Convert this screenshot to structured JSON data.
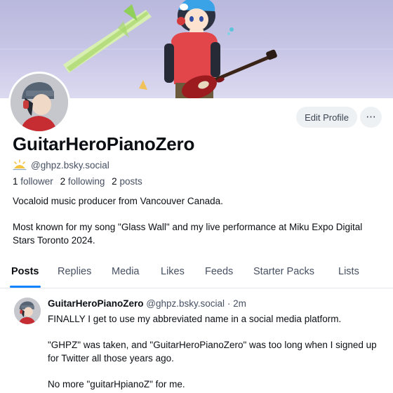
{
  "header": {
    "edit_profile_label": "Edit Profile",
    "more_label": "···"
  },
  "profile": {
    "display_name": "GuitarHeroPianoZero",
    "handle": "@ghpz.bsky.social",
    "followers_count": "1",
    "followers_label": "follower",
    "following_count": "2",
    "following_label": "following",
    "posts_count": "2",
    "posts_label": "posts",
    "bio_line1": "Vocaloid music producer from Vancouver Canada.",
    "bio_line2": "Most known for my song \"Glass Wall\" and my live performance at Miku Expo Digital Stars Toronto 2024."
  },
  "tabs": [
    {
      "label": "Posts",
      "active": true
    },
    {
      "label": "Replies",
      "active": false
    },
    {
      "label": "Media",
      "active": false
    },
    {
      "label": "Likes",
      "active": false
    },
    {
      "label": "Feeds",
      "active": false
    },
    {
      "label": "Starter Packs",
      "active": false
    },
    {
      "label": "Lists",
      "active": false
    }
  ],
  "post": {
    "author_name": "GuitarHeroPianoZero",
    "author_handle": "@ghpz.bsky.social",
    "separator": "·",
    "time": "2m",
    "paragraphs": [
      "FINALLY I get to use my abbreviated name in a social media platform.",
      "\"GHPZ\" was taken, and \"GuitarHeroPianoZero\" was too long when I signed up for Twitter all those years ago.",
      "No more \"guitarHpianoZ\" for me."
    ]
  },
  "icons": {
    "handle_badge": "sun-icon",
    "more": "ellipsis-icon"
  },
  "colors": {
    "accent": "#1083fe",
    "banner_bg": "#c9c7e6",
    "muted_text": "#465062",
    "button_bg": "#eef1f4"
  }
}
